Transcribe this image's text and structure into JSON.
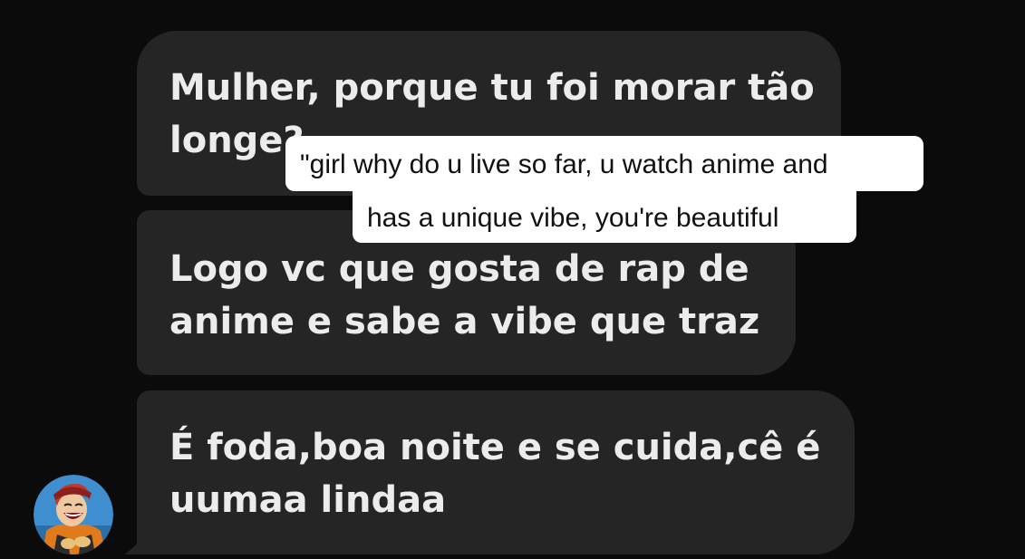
{
  "messages": [
    {
      "lines": [
        "Mulher, porque tu foi morar tão",
        "longe?"
      ]
    },
    {
      "lines": [
        "Logo vc que gosta de rap de",
        "anime e sabe a vibe que traz"
      ]
    },
    {
      "lines": [
        "É foda,boa noite e se cuida,cê é",
        "uumaa lindaa"
      ]
    }
  ],
  "caption_overlay": {
    "line1": "\"girl why do u live so far, u watch anime and",
    "line2": "has a unique vibe, you're beautiful"
  },
  "colors": {
    "background": "#0b0b0b",
    "bubble": "#252525",
    "bubble_text": "#ececec",
    "caption_bg": "#ffffff",
    "caption_text": "#111111"
  },
  "icons": {
    "avatar": "anime-character-avatar"
  }
}
